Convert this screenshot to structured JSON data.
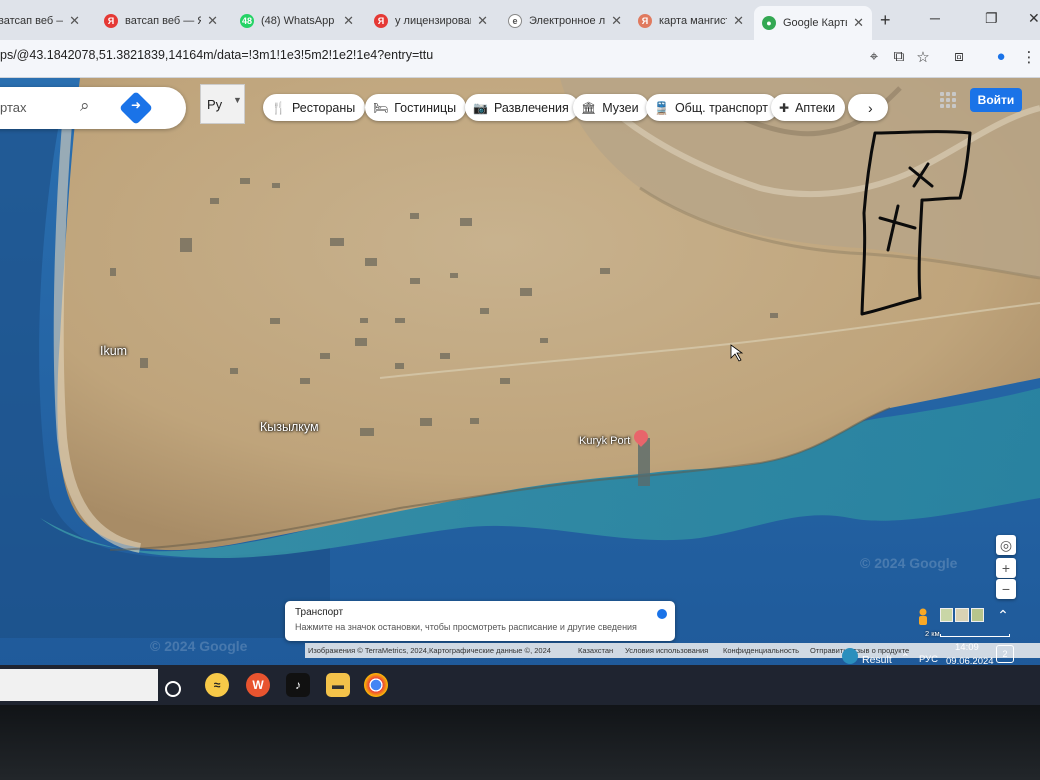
{
  "tabs": [
    {
      "title": "ватсап веб — Яндекс",
      "favicon": "yandex",
      "color": "#e53935",
      "active": false
    },
    {
      "title": "ватсап веб — Яндекс",
      "favicon": "yandex",
      "color": "#e53935",
      "active": false
    },
    {
      "title": "(48) WhatsApp",
      "favicon": "whatsapp",
      "color": "#25d366",
      "active": false
    },
    {
      "title": "у лицензированного",
      "favicon": "yandex",
      "color": "#e53935",
      "active": false
    },
    {
      "title": "Электронное лицензирование",
      "favicon": "elicense",
      "color": "#555555",
      "active": false
    },
    {
      "title": "карта мангистау",
      "favicon": "yandex",
      "color": "#e07a5f",
      "active": false
    },
    {
      "title": "Google Карты",
      "favicon": "google-maps",
      "color": "#34a853",
      "active": true
    }
  ],
  "address": {
    "url": "ps/@43.1842078,51.3821839,14164m/data=!3m1!1e3!5m2!1e2!1e4?entry=ttu"
  },
  "search": {
    "placeholder": "ртах"
  },
  "lang": {
    "value": "Ру"
  },
  "chips": [
    {
      "label": "Рестораны",
      "icon": "restaurant-icon",
      "glyph": "🍴"
    },
    {
      "label": "Гостиницы",
      "icon": "hotel-icon",
      "glyph": "🛏"
    },
    {
      "label": "Развлечения",
      "icon": "camera-icon",
      "glyph": "📷"
    },
    {
      "label": "Музеи",
      "icon": "museum-icon",
      "glyph": "🏛"
    },
    {
      "label": "Общ. транспорт",
      "icon": "transit-icon",
      "glyph": "🚆"
    },
    {
      "label": "Аптеки",
      "icon": "pharmacy-icon",
      "glyph": "✚"
    }
  ],
  "login_label": "Войти",
  "map_labels": {
    "ikum": "Ikum",
    "kyzylkum": "Кызылкум",
    "kuryk": "Kuryk Port"
  },
  "watermark": "© 2024 Google",
  "toast": {
    "title": "Транспорт",
    "text": "Нажмите на значок остановки, чтобы просмотреть расписание и другие сведения"
  },
  "attribution": {
    "imagery": "Изображения © TerraMetrics, 2024,Картографические данные ©, 2024",
    "country": "Казахстан",
    "terms": "Условия использования",
    "privacy": "Конфиденциальность",
    "feedback": "Отправить отзыв о продукте",
    "scale": "2 км"
  },
  "tray": {
    "app": "Result",
    "lang": "РУС",
    "time": "14:09",
    "date": "09.06.2024",
    "notifications": "2"
  }
}
